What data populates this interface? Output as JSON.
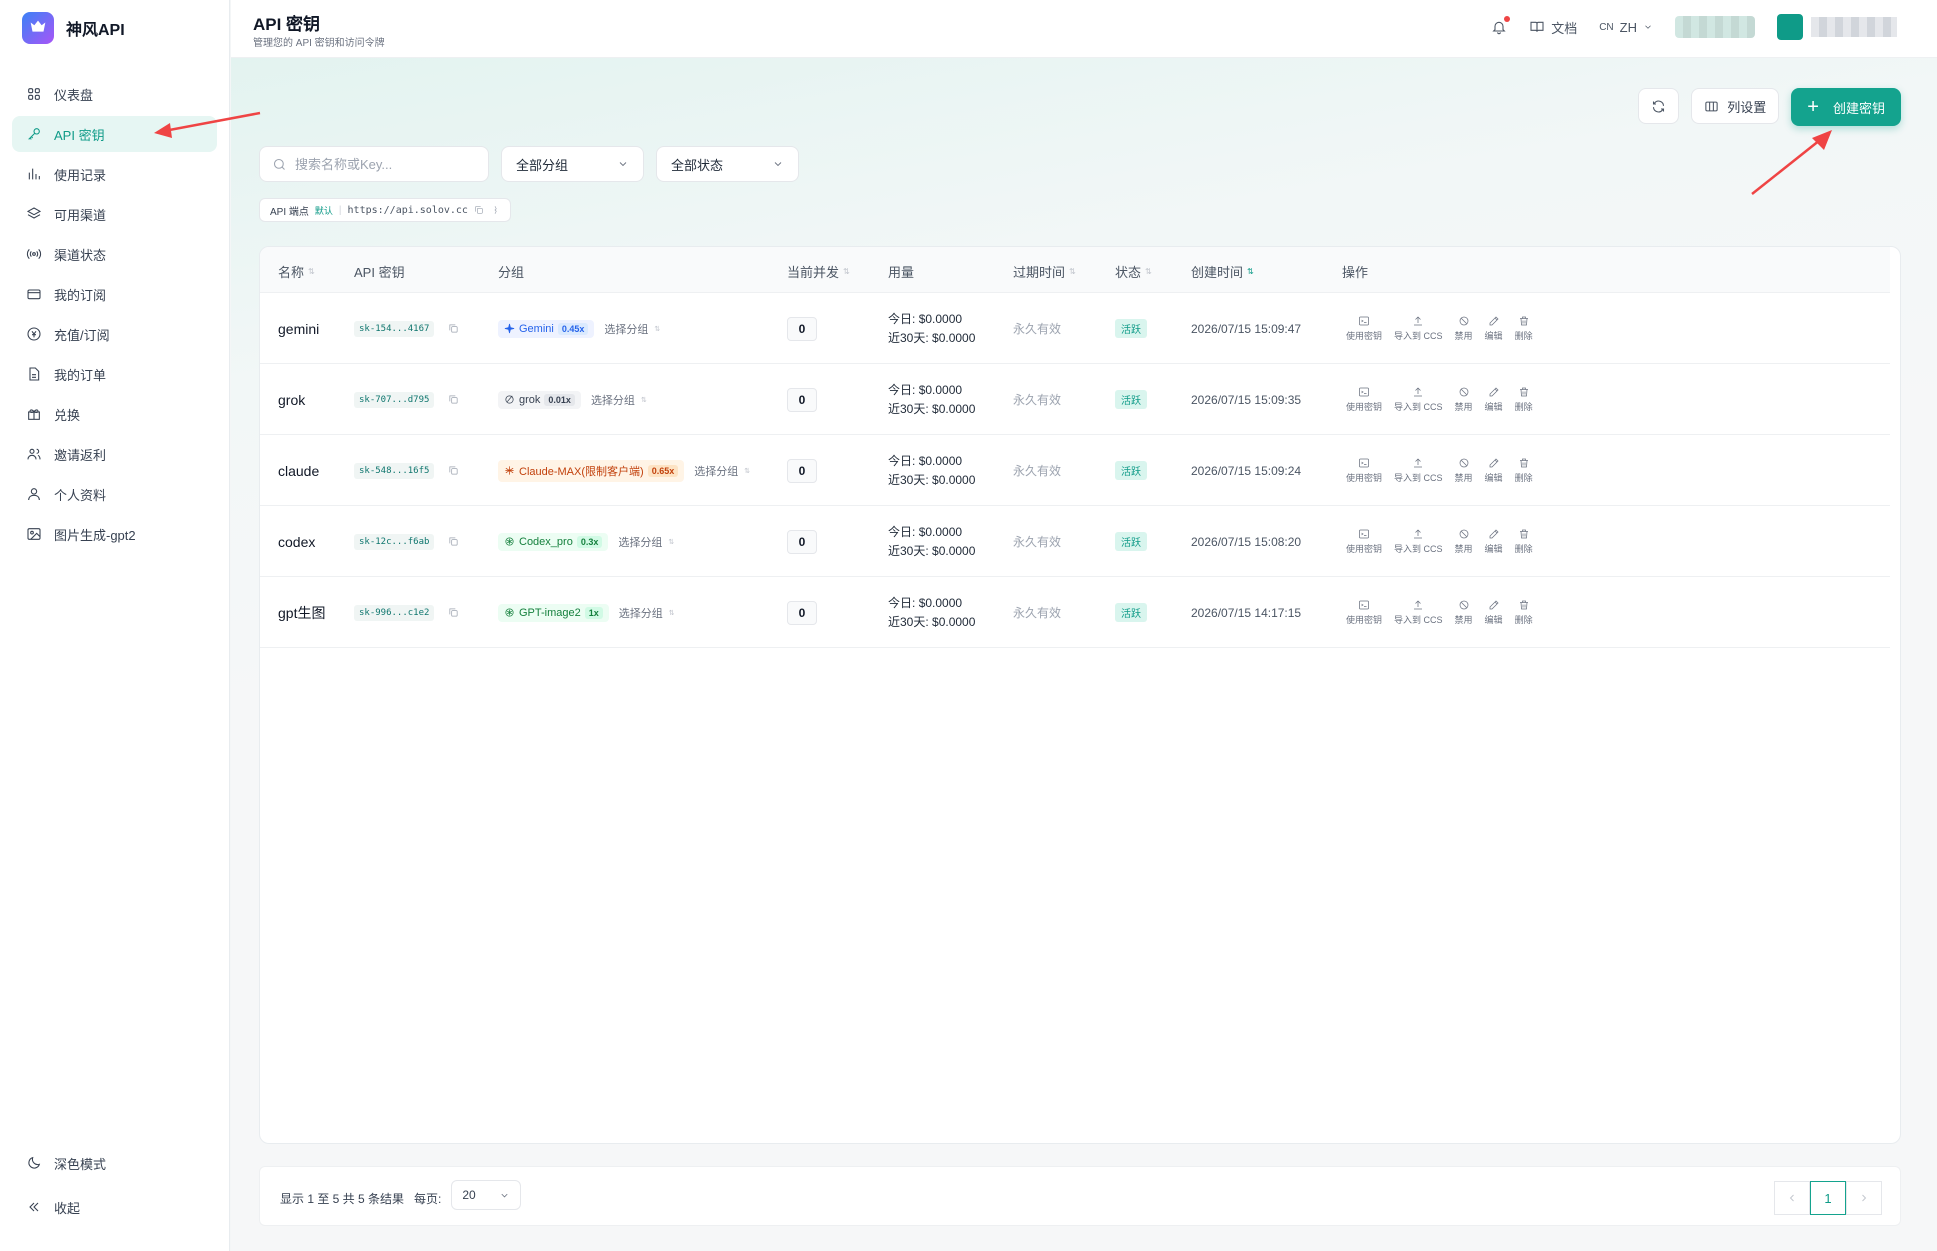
{
  "brand": {
    "name": "神风API",
    "logo_text": "神风API"
  },
  "sidebar": {
    "items": [
      {
        "label": "仪表盘",
        "icon": "grid-icon"
      },
      {
        "label": "API 密钥",
        "icon": "key-icon",
        "active": true
      },
      {
        "label": "使用记录",
        "icon": "bar-chart-icon"
      },
      {
        "label": "可用渠道",
        "icon": "layers-icon"
      },
      {
        "label": "渠道状态",
        "icon": "signal-icon"
      },
      {
        "label": "我的订阅",
        "icon": "card-icon"
      },
      {
        "label": "充值/订阅",
        "icon": "coin-icon"
      },
      {
        "label": "我的订单",
        "icon": "document-icon"
      },
      {
        "label": "兑换",
        "icon": "gift-icon"
      },
      {
        "label": "邀请返利",
        "icon": "users-icon"
      },
      {
        "label": "个人资料",
        "icon": "user-icon"
      },
      {
        "label": "图片生成-gpt2",
        "icon": "image-icon"
      }
    ],
    "bottom": [
      {
        "label": "深色模式",
        "icon": "moon-icon"
      },
      {
        "label": "收起",
        "icon": "collapse-icon"
      }
    ]
  },
  "header": {
    "title": "API 密钥",
    "subtitle": "管理您的 API 密钥和访问令牌",
    "docs_label": "文档",
    "lang_prefix": "CN",
    "lang_label": "ZH"
  },
  "toolbar": {
    "columns_label": "列设置",
    "create_label": "创建密钥"
  },
  "filters": {
    "search_placeholder": "搜索名称或Key...",
    "group_select": "全部分组",
    "status_select": "全部状态"
  },
  "endpoint": {
    "label": "API 端点",
    "default_tag": "默认",
    "url": "https://api.solov.cc"
  },
  "table": {
    "columns": [
      "名称",
      "API 密钥",
      "分组",
      "当前并发",
      "用量",
      "过期时间",
      "状态",
      "创建时间",
      "操作"
    ],
    "pick_group_label": "选择分组",
    "today_label": "今日:",
    "month_label": "近30天:",
    "action_labels": [
      "使用密钥",
      "导入到 CCS",
      "禁用",
      "编辑",
      "删除"
    ],
    "rows": [
      {
        "name": "gemini",
        "key": "sk-154...4167",
        "group": "Gemini",
        "group_icon": "sparkle-icon",
        "multiplier": "0.45x",
        "group_color": "#2563eb",
        "group_bg": "#eef2ff",
        "mult_bg": "#dbeafe",
        "concurrency": "0",
        "today": "$0.0000",
        "month": "$0.0000",
        "expiry": "永久有效",
        "status": "活跃",
        "created": "2026/07/15 15:09:47"
      },
      {
        "name": "grok",
        "key": "sk-707...d795",
        "group": "grok",
        "group_icon": "circle-slash-icon",
        "multiplier": "0.01x",
        "group_color": "#374151",
        "group_bg": "#f3f4f6",
        "mult_bg": "#e5e7eb",
        "concurrency": "0",
        "today": "$0.0000",
        "month": "$0.0000",
        "expiry": "永久有效",
        "status": "活跃",
        "created": "2026/07/15 15:09:35"
      },
      {
        "name": "claude",
        "key": "sk-548...16f5",
        "group": "Claude-MAX(限制客户端)",
        "group_icon": "asterisk-icon",
        "multiplier": "0.65x",
        "group_color": "#c2410c",
        "group_bg": "#fff4e6",
        "mult_bg": "#fde3c4",
        "concurrency": "0",
        "today": "$0.0000",
        "month": "$0.0000",
        "expiry": "永久有效",
        "status": "活跃",
        "created": "2026/07/15 15:09:24"
      },
      {
        "name": "codex",
        "key": "sk-12c...f6ab",
        "group": "Codex_pro",
        "group_icon": "openai-icon",
        "multiplier": "0.3x",
        "group_color": "#15803d",
        "group_bg": "#ecfdf3",
        "mult_bg": "#d1fae5",
        "concurrency": "0",
        "today": "$0.0000",
        "month": "$0.0000",
        "expiry": "永久有效",
        "status": "活跃",
        "created": "2026/07/15 15:08:20"
      },
      {
        "name": "gpt生图",
        "key": "sk-996...c1e2",
        "group": "GPT-image2",
        "group_icon": "openai-icon",
        "multiplier": "1x",
        "group_color": "#15803d",
        "group_bg": "#ecfdf3",
        "mult_bg": "#d1fae5",
        "concurrency": "0",
        "today": "$0.0000",
        "month": "$0.0000",
        "expiry": "永久有效",
        "status": "活跃",
        "created": "2026/07/15 14:17:15"
      }
    ]
  },
  "pagination": {
    "summary": "显示 1 至 5 共 5 条结果",
    "per_page_label": "每页:",
    "per_page": "20",
    "current_page": "1"
  },
  "colors": {
    "accent": "#14a38e",
    "arrow": "#ef4444"
  }
}
